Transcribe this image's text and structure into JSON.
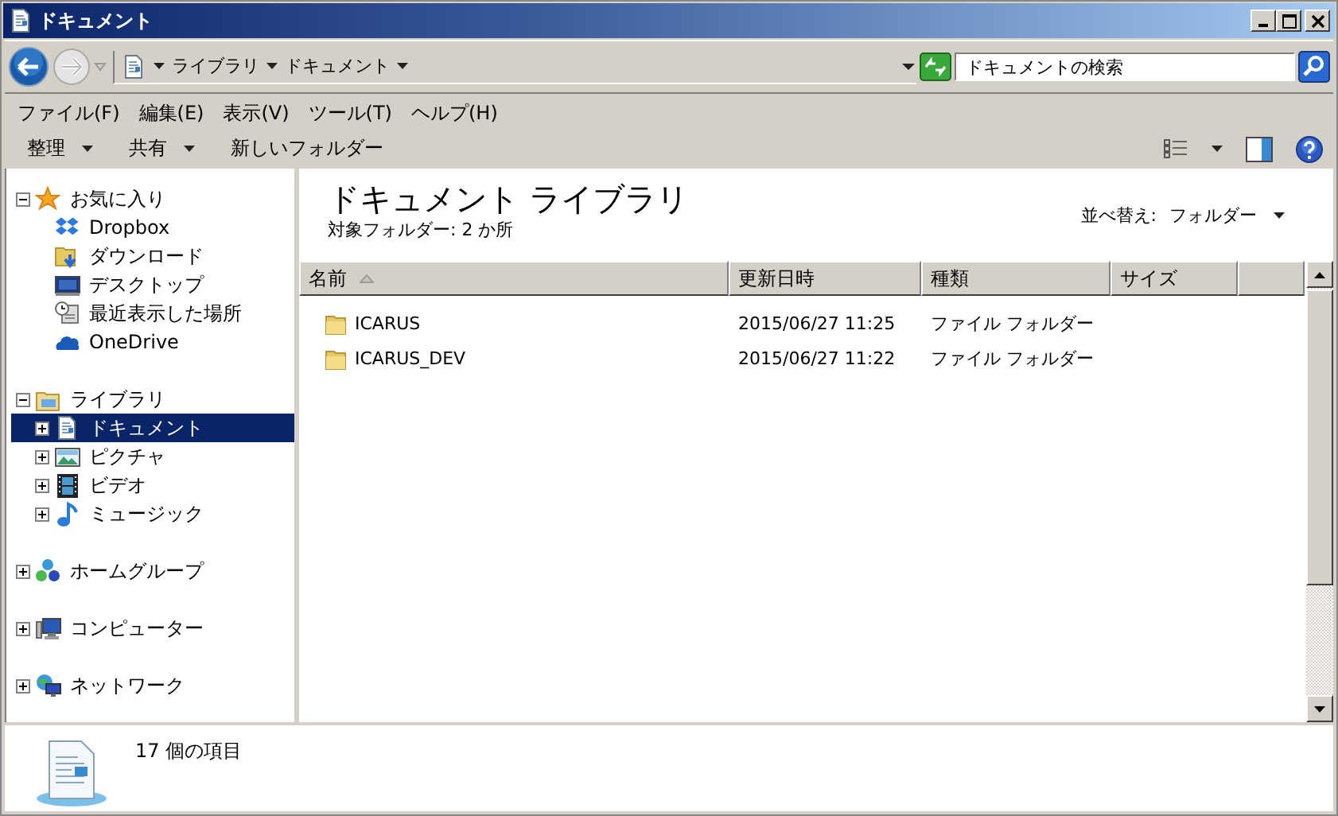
{
  "window": {
    "title": "ドキュメント"
  },
  "address": {
    "crumbs": [
      "ライブラリ",
      "ドキュメント"
    ]
  },
  "search": {
    "placeholder": "ドキュメントの検索"
  },
  "menu": [
    "ファイル(F)",
    "編集(E)",
    "表示(V)",
    "ツール(T)",
    "ヘルプ(H)"
  ],
  "commands": [
    {
      "label": "整理",
      "dropdown": true
    },
    {
      "label": "共有",
      "dropdown": true
    },
    {
      "label": "新しいフォルダー",
      "dropdown": false
    }
  ],
  "tree": [
    {
      "label": "お気に入り",
      "expanded": true,
      "selected": false,
      "children": [
        {
          "label": "Dropbox",
          "selected": false
        },
        {
          "label": "ダウンロード",
          "selected": false
        },
        {
          "label": "デスクトップ",
          "selected": false
        },
        {
          "label": "最近表示した場所",
          "selected": false
        },
        {
          "label": "OneDrive",
          "selected": false
        }
      ]
    },
    {
      "label": "ライブラリ",
      "expanded": true,
      "selected": false,
      "children": [
        {
          "label": "ドキュメント",
          "expanded": false,
          "selected": true
        },
        {
          "label": "ピクチャ",
          "expanded": false,
          "selected": false
        },
        {
          "label": "ビデオ",
          "expanded": false,
          "selected": false
        },
        {
          "label": "ミュージック",
          "expanded": false,
          "selected": false
        }
      ]
    },
    {
      "label": "ホームグループ",
      "expanded": false,
      "selected": false
    },
    {
      "label": "コンピューター",
      "expanded": false,
      "selected": false
    },
    {
      "label": "ネットワーク",
      "expanded": false,
      "selected": false
    }
  ],
  "library": {
    "title": "ドキュメント ライブラリ",
    "subtitle": "対象フォルダー:  2 か所",
    "sort_label": "並べ替え:",
    "sort_value": "フォルダー"
  },
  "table": {
    "columns": [
      {
        "label": "名前",
        "sorted": true
      },
      {
        "label": "更新日時",
        "sorted": false
      },
      {
        "label": "種類",
        "sorted": false
      },
      {
        "label": "サイズ",
        "sorted": false
      }
    ],
    "rows": [
      {
        "name": "ICARUS",
        "modified": "2015/06/27 11:25",
        "type": "ファイル フォルダー"
      },
      {
        "name": "ICARUS_DEV",
        "modified": "2015/06/27 11:22",
        "type": "ファイル フォルダー"
      }
    ]
  },
  "status_bar": {
    "text": "17 個の項目"
  }
}
